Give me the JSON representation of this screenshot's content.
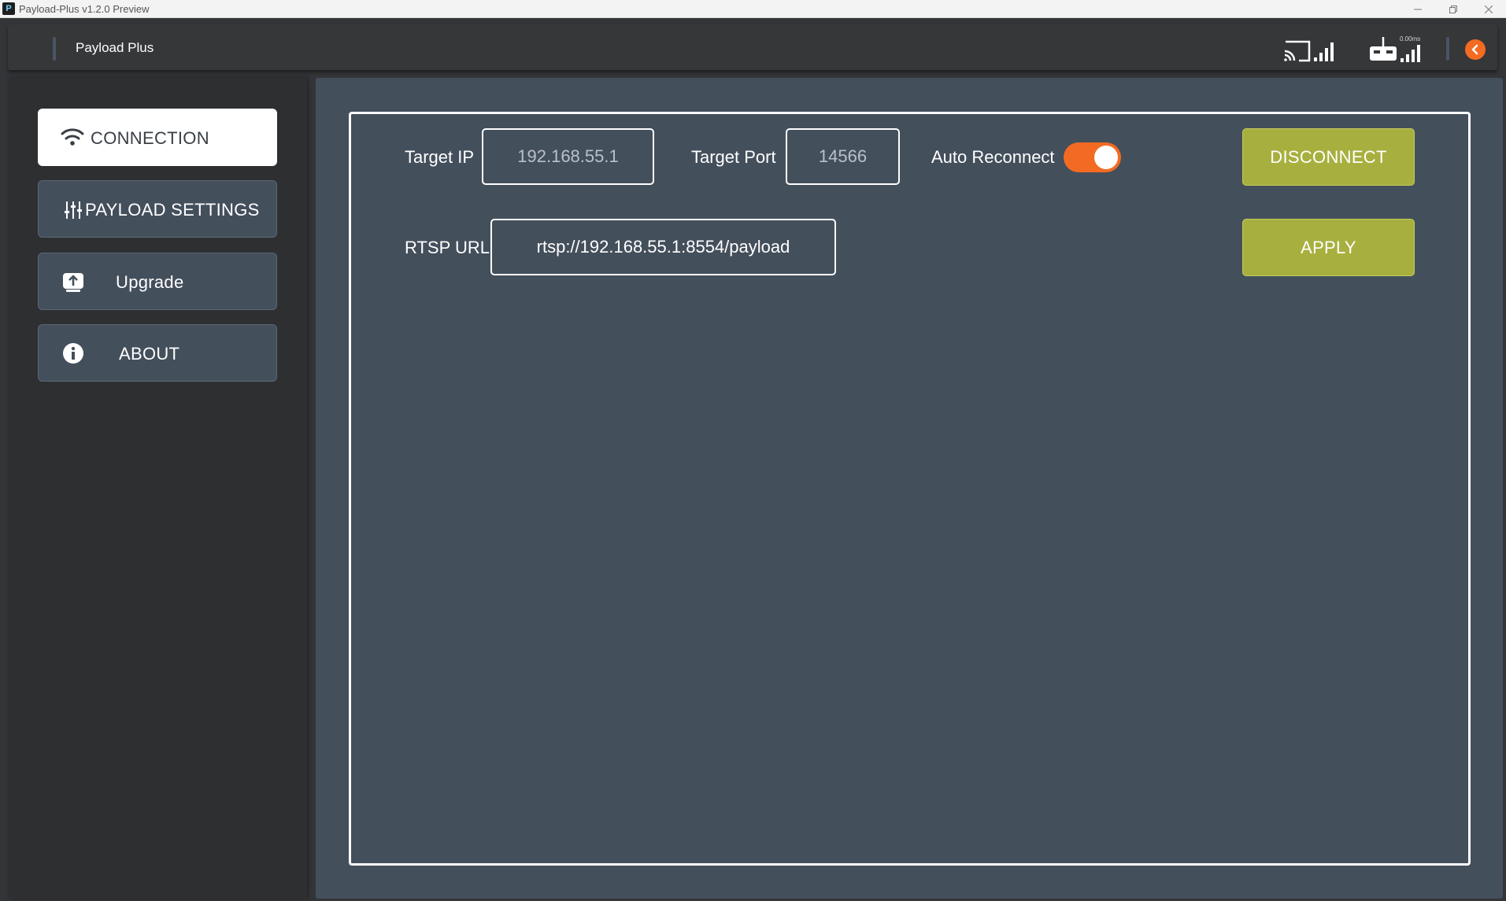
{
  "window": {
    "title": "Payload-Plus v1.2.0 Preview",
    "logo_letter": "P"
  },
  "header": {
    "title": "Payload Plus",
    "latency": "0.00ms",
    "icons": [
      "cast-icon",
      "signal-icon",
      "controller-icon",
      "signal-icon",
      "back-arrow-icon"
    ]
  },
  "sidebar": {
    "items": [
      {
        "label": "CONNECTION",
        "icon": "wifi-icon",
        "active": true
      },
      {
        "label": "PAYLOAD SETTINGS",
        "icon": "sliders-icon",
        "active": false
      },
      {
        "label": "Upgrade",
        "icon": "upload-icon",
        "active": false
      },
      {
        "label": "ABOUT",
        "icon": "info-icon",
        "active": false
      }
    ]
  },
  "connection": {
    "target_ip_label": "Target IP",
    "target_ip_placeholder": "192.168.55.1",
    "target_port_label": "Target Port",
    "target_port_placeholder": "14566",
    "auto_reconnect_label": "Auto Reconnect",
    "auto_reconnect_on": true,
    "rtsp_label": "RTSP URL",
    "rtsp_value": "rtsp://192.168.55.1:8554/payload",
    "disconnect_label": "DISCONNECT",
    "apply_label": "APPLY"
  },
  "colors": {
    "accent_orange": "#f36b22",
    "button_green": "#a7b03f",
    "panel_bg": "#444f5c",
    "sidebar_bg": "#2e2f31"
  }
}
